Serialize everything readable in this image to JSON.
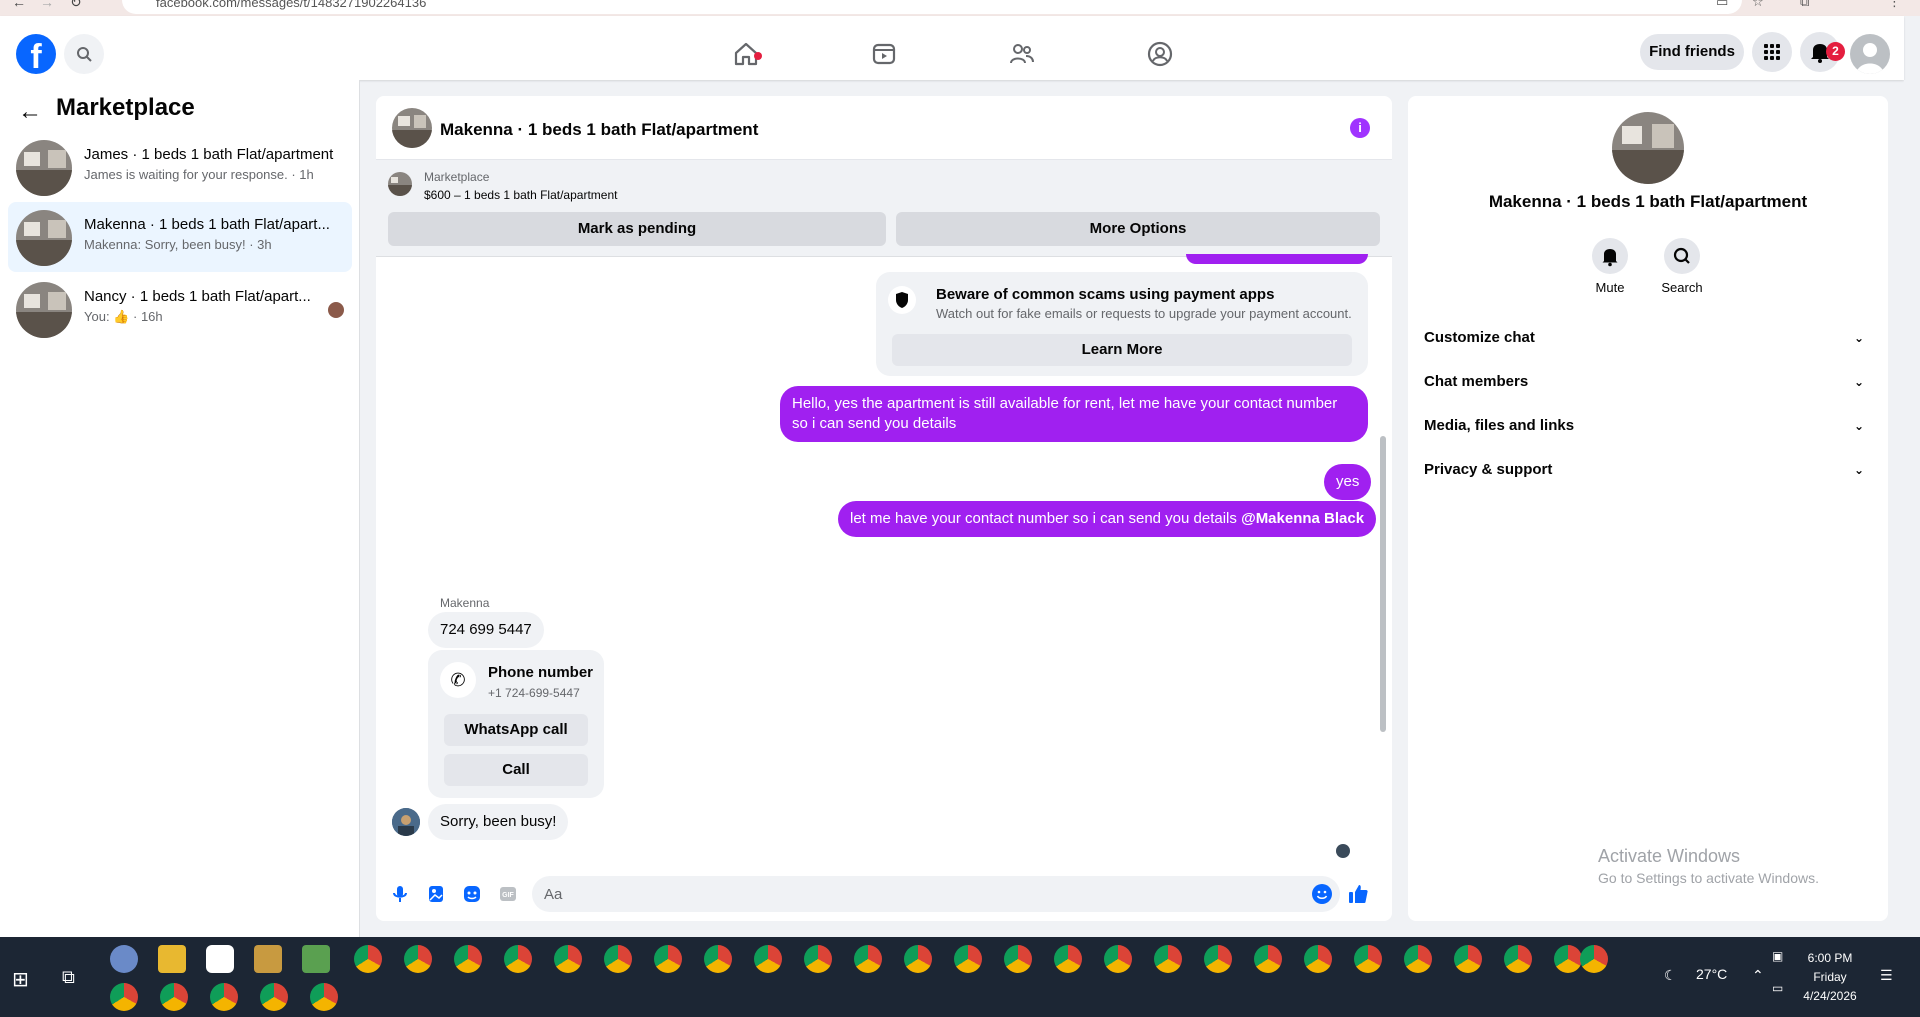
{
  "browser": {
    "url": "facebook.com/messages/t/1483271902264136"
  },
  "topbar": {
    "logo": "f",
    "find_friends": "Find friends",
    "notification_count": "2"
  },
  "sidebar": {
    "title": "Marketplace",
    "conversations": [
      {
        "title": "James · 1 beds 1 bath Flat/apartment",
        "sub": "James is waiting for your response. · 1h"
      },
      {
        "title": "Makenna · 1 beds 1 bath Flat/apart...",
        "sub": "Makenna: Sorry, been busy! · 3h"
      },
      {
        "title": "Nancy · 1 beds 1 bath Flat/apart...",
        "sub_prefix": "You:",
        "sub_suffix": "· 16h"
      }
    ]
  },
  "chat": {
    "header_title": "Makenna · 1 beds 1 bath Flat/apartment",
    "marketplace_label": "Marketplace",
    "listing": "$600 – 1 beds 1 bath Flat/apartment",
    "mark_pending": "Mark as pending",
    "more_options": "More Options",
    "scam": {
      "title": "Beware of common scams using payment apps",
      "desc": "Watch out for fake emails or requests to upgrade your payment account.",
      "button": "Learn More"
    },
    "messages": {
      "out1": "Hello, yes the apartment is still available for rent, let me have your contact number so i can send you details",
      "out2": "yes",
      "out3": "let me have your contact number so i can send you details",
      "out3_mention": "@Makenna Black",
      "sender": "Makenna",
      "in1": "724 699 5447",
      "in_last": "Sorry, been busy!"
    },
    "phone_card": {
      "title": "Phone number",
      "number": "+1 724-699-5447",
      "whatsapp": "WhatsApp call",
      "call": "Call"
    },
    "composer_placeholder": "Aa"
  },
  "right_panel": {
    "name": "Makenna · 1 beds 1 bath Flat/apartment",
    "mute": "Mute",
    "search": "Search",
    "sections": [
      "Customize chat",
      "Chat members",
      "Media, files and links",
      "Privacy & support"
    ]
  },
  "watermark": {
    "line1": "Activate Windows",
    "line2": "Go to Settings to activate Windows."
  },
  "taskbar": {
    "temperature": "27°C",
    "time": "6:00 PM",
    "day": "Friday",
    "date": "4/24/2026"
  },
  "colors": {
    "accent": "#a020f0",
    "fb_blue": "#0866ff"
  }
}
